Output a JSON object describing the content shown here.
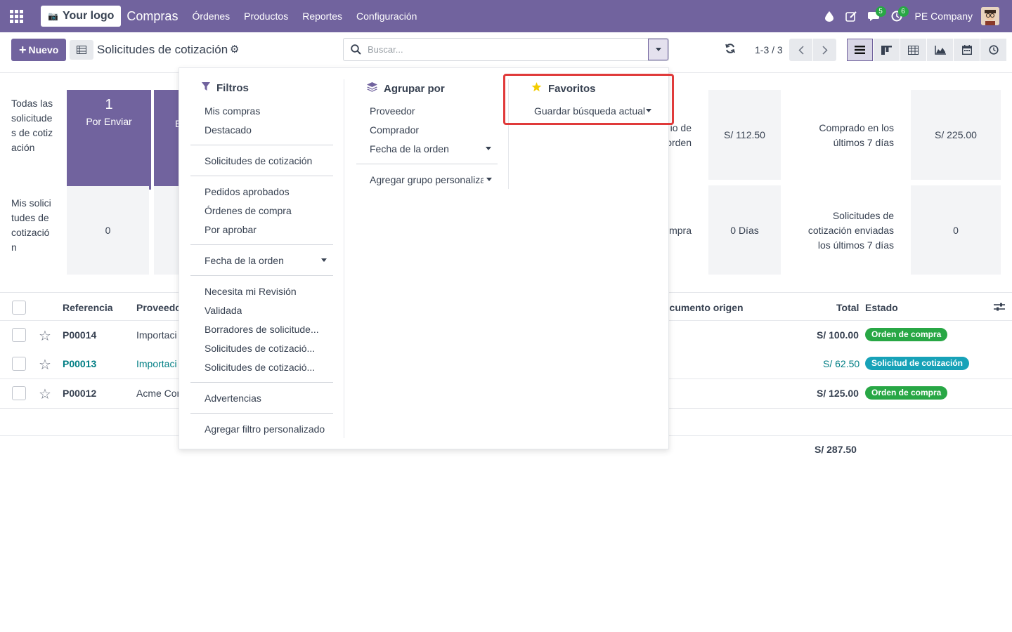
{
  "navbar": {
    "logo": "Your logo",
    "app_name": "Compras",
    "menu": [
      "Órdenes",
      "Productos",
      "Reportes",
      "Configuración"
    ],
    "chat_count": "5",
    "activity_count": "6",
    "company": "PE Company"
  },
  "control_panel": {
    "new_button": "Nuevo",
    "title": "Solicitudes de cotización",
    "search_placeholder": "Buscar...",
    "pager": "1-3 / 3"
  },
  "dashboard": {
    "row1_label": "Todas las solicitudes de cotización",
    "row2_label": "Mis solicitudes de cotización",
    "tile_por_enviar_count": "1",
    "tile_por_enviar_label": "Por Enviar",
    "tile_partial_label": "E",
    "mis_value": "0",
    "partial_label_1a": "io de",
    "partial_label_1b": "orden",
    "avg_value": "S/ 112.50",
    "purchased_label": "Comprado en los últimos 7 días",
    "purchased_value": "S/ 225.00",
    "partial_label_2": "mpra",
    "days_value": "0 Días",
    "sent_label": "Solicitudes de cotización enviadas los últimos 7 días",
    "sent_value": "0"
  },
  "table": {
    "headers": {
      "reference": "Referencia",
      "vendor": "Proveedo",
      "source": "ocumento origen",
      "total": "Total",
      "status": "Estado"
    },
    "rows": [
      {
        "ref": "P00014",
        "vendor": "Importaci",
        "total": "S/ 100.00",
        "status": "Orden de compra"
      },
      {
        "ref": "P00013",
        "vendor": "Importaci",
        "total": "S/ 62.50",
        "status": "Solicitud de cotización"
      },
      {
        "ref": "P00012",
        "vendor": "Acme Cor",
        "total": "S/ 125.00",
        "status": "Orden de compra"
      }
    ],
    "grand_total": "S/ 287.50"
  },
  "dropdown": {
    "filters": {
      "title": "Filtros",
      "items": [
        "Mis compras",
        "Destacado",
        "Solicitudes de cotización",
        "Pedidos aprobados",
        "Órdenes de compra",
        "Por aprobar",
        "Fecha de la orden",
        "Necesita mi Revisión",
        "Validada",
        "Borradores de solicitude...",
        "Solicitudes de cotizació...",
        "Solicitudes de cotizació...",
        "Advertencias",
        "Agregar filtro personalizado"
      ]
    },
    "group_by": {
      "title": "Agrupar por",
      "items": [
        "Proveedor",
        "Comprador",
        "Fecha de la orden",
        "Agregar grupo personaliza"
      ]
    },
    "favorites": {
      "title": "Favoritos",
      "save_search": "Guardar búsqueda actual"
    }
  },
  "colors": {
    "brand": "#71639e",
    "green_badge": "#28a745",
    "teal_badge": "#17a2b8",
    "highlight": "#e03a3a",
    "link": "#017e84"
  }
}
